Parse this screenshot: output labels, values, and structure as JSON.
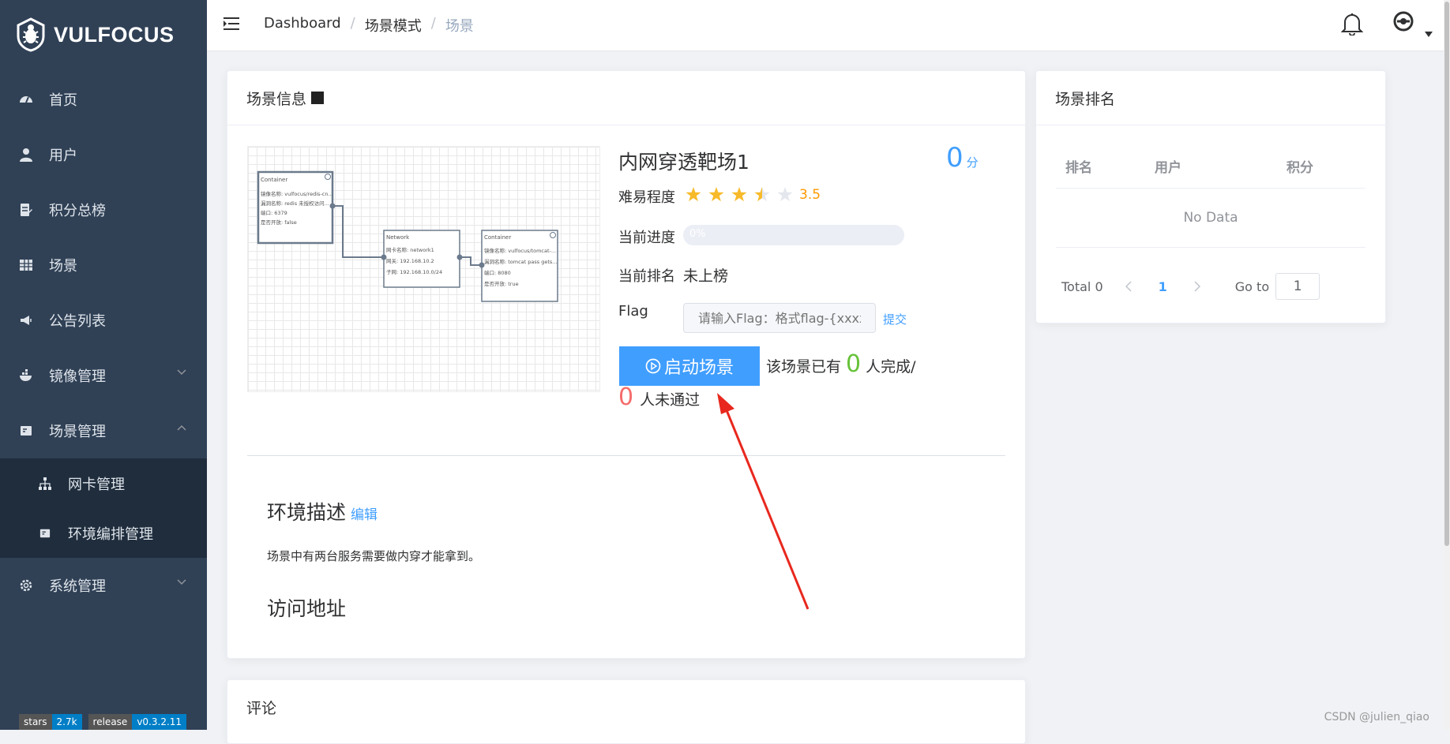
{
  "app": {
    "logo_text": "VULFOCUS"
  },
  "sidebar": {
    "items": [
      {
        "label": "首页",
        "icon": "dashboard-icon"
      },
      {
        "label": "用户",
        "icon": "user-icon"
      },
      {
        "label": "积分总榜",
        "icon": "ranking-icon"
      },
      {
        "label": "场景",
        "icon": "table-grid-icon"
      },
      {
        "label": "公告列表",
        "icon": "megaphone-icon"
      },
      {
        "label": "镜像管理",
        "icon": "docker-icon"
      },
      {
        "label": "场景管理",
        "icon": "form-icon"
      }
    ],
    "sub_items": [
      {
        "label": "网卡管理",
        "icon": "network-tree-icon"
      },
      {
        "label": "环境编排管理",
        "icon": "form-icon"
      }
    ],
    "system_item": {
      "label": "系统管理",
      "icon": "gear-icon"
    },
    "badges": [
      {
        "left": "stars",
        "right": "2.7k"
      },
      {
        "left": "release",
        "right": "v0.3.2.11"
      }
    ]
  },
  "breadcrumb": {
    "items": [
      "Dashboard",
      "场景模式",
      "场景"
    ],
    "separator": "/"
  },
  "scene_card": {
    "header": "场景信息",
    "title": "内网穿透靶场1",
    "score": "0",
    "score_unit": "分",
    "difficulty_label": "难易程度",
    "rating": 3.5,
    "rating_text": "3.5",
    "progress_label": "当前进度",
    "progress_percent": 0,
    "progress_text": "0%",
    "rank_label": "当前排名",
    "rank_value": "未上榜",
    "flag_label": "Flag",
    "flag_placeholder": "请输入Flag：格式flag-{xxxxx}",
    "submit_label": "提交",
    "start_button": "启动场景",
    "completed_prefix": "该场景已有",
    "completed_count": "0",
    "completed_suffix": "人完成/",
    "failed_count": "0",
    "failed_suffix": "人未通过",
    "env_title": "环境描述",
    "edit_label": "编辑",
    "env_desc": "场景中有两台服务需要做内穿才能拿到。",
    "access_title": "访问地址"
  },
  "topology": {
    "nodes": [
      {
        "title": "Container",
        "lines": [
          "镜像名称: vulfocus/redis-cn...",
          "漏洞名称: redis 未授权访问...",
          "端口: 6379",
          "是否开放: false"
        ]
      },
      {
        "title": "Network",
        "lines": [
          "网卡名称: network1",
          "网关: 192.168.10.2",
          "子网: 192.168.10.0/24"
        ]
      },
      {
        "title": "Container",
        "lines": [
          "镜像名称: vulfocus/tomcat-...",
          "漏洞名称: tomcat pass gets...",
          "端口: 8080",
          "是否开放: true"
        ]
      }
    ]
  },
  "ranking_card": {
    "header": "场景排名",
    "columns": [
      "排名",
      "用户",
      "积分"
    ],
    "empty_text": "No Data",
    "total_text": "Total 0",
    "current_page": "1",
    "goto_label": "Go to",
    "goto_value": "1"
  },
  "comment_card": {
    "header": "评论"
  },
  "watermark": "CSDN @julien_qiao",
  "colors": {
    "sidebar": "#304156",
    "primary": "#409eff",
    "success": "#67c23a",
    "danger": "#f56c6c",
    "warning": "#ff9900"
  }
}
